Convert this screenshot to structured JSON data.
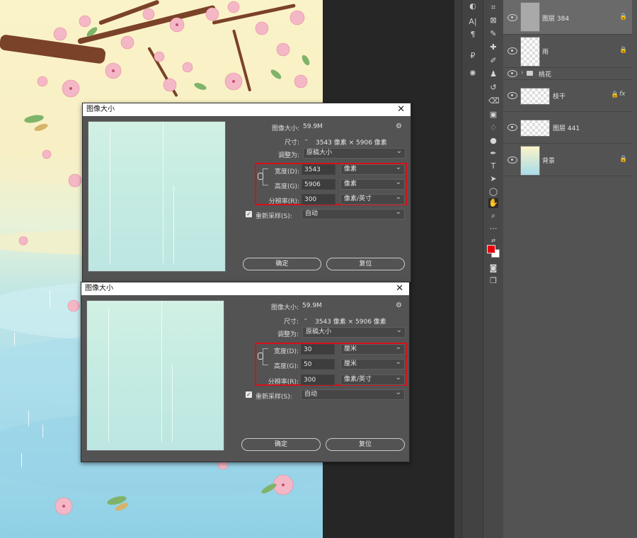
{
  "layers_panel": {
    "layers": [
      {
        "name": "图层 384",
        "selected": true,
        "locked": true
      },
      {
        "name": "雨",
        "selected": false,
        "locked": true
      },
      {
        "name": "桃花",
        "group": true
      },
      {
        "name": "枝干",
        "selected": false,
        "locked": true,
        "fx": "fx"
      },
      {
        "name": "图层 441",
        "selected": false,
        "locked": false
      },
      {
        "name": "背景",
        "selected": false,
        "locked": true
      }
    ]
  },
  "dialogs": [
    {
      "title": "图像大小",
      "image_size_label": "图像大小:",
      "image_size_value": "59.9M",
      "dimensions_label": "尺寸:",
      "dimensions_value": "3543 像素 × 5906 像素",
      "fit_to_label": "调整为:",
      "fit_to_value": "原稿大小",
      "width_label": "宽度(D):",
      "width_value": "3543",
      "width_unit": "像素",
      "height_label": "高度(G):",
      "height_value": "5906",
      "height_unit": "像素",
      "resolution_label": "分辨率(R):",
      "resolution_value": "300",
      "resolution_unit": "像素/英寸",
      "resample_label": "重新采样(S):",
      "resample_value": "自动",
      "ok_label": "确定",
      "reset_label": "复位"
    },
    {
      "title": "图像大小",
      "image_size_label": "图像大小:",
      "image_size_value": "59.9M",
      "dimensions_label": "尺寸:",
      "dimensions_value": "3543 像素 × 5906 像素",
      "fit_to_label": "调整为:",
      "fit_to_value": "原稿大小",
      "width_label": "宽度(D):",
      "width_value": "30",
      "width_unit": "厘米",
      "height_label": "高度(G):",
      "height_value": "50",
      "height_unit": "厘米",
      "resolution_label": "分辨率(R):",
      "resolution_value": "300",
      "resolution_unit": "像素/英寸",
      "resample_label": "重新采样(S):",
      "resample_value": "自动",
      "ok_label": "确定",
      "reset_label": "复位"
    }
  ],
  "colors": {
    "highlight_box": "#d61018",
    "foreground_swatch": "#e8000b",
    "background_swatch": "#ffffff"
  }
}
